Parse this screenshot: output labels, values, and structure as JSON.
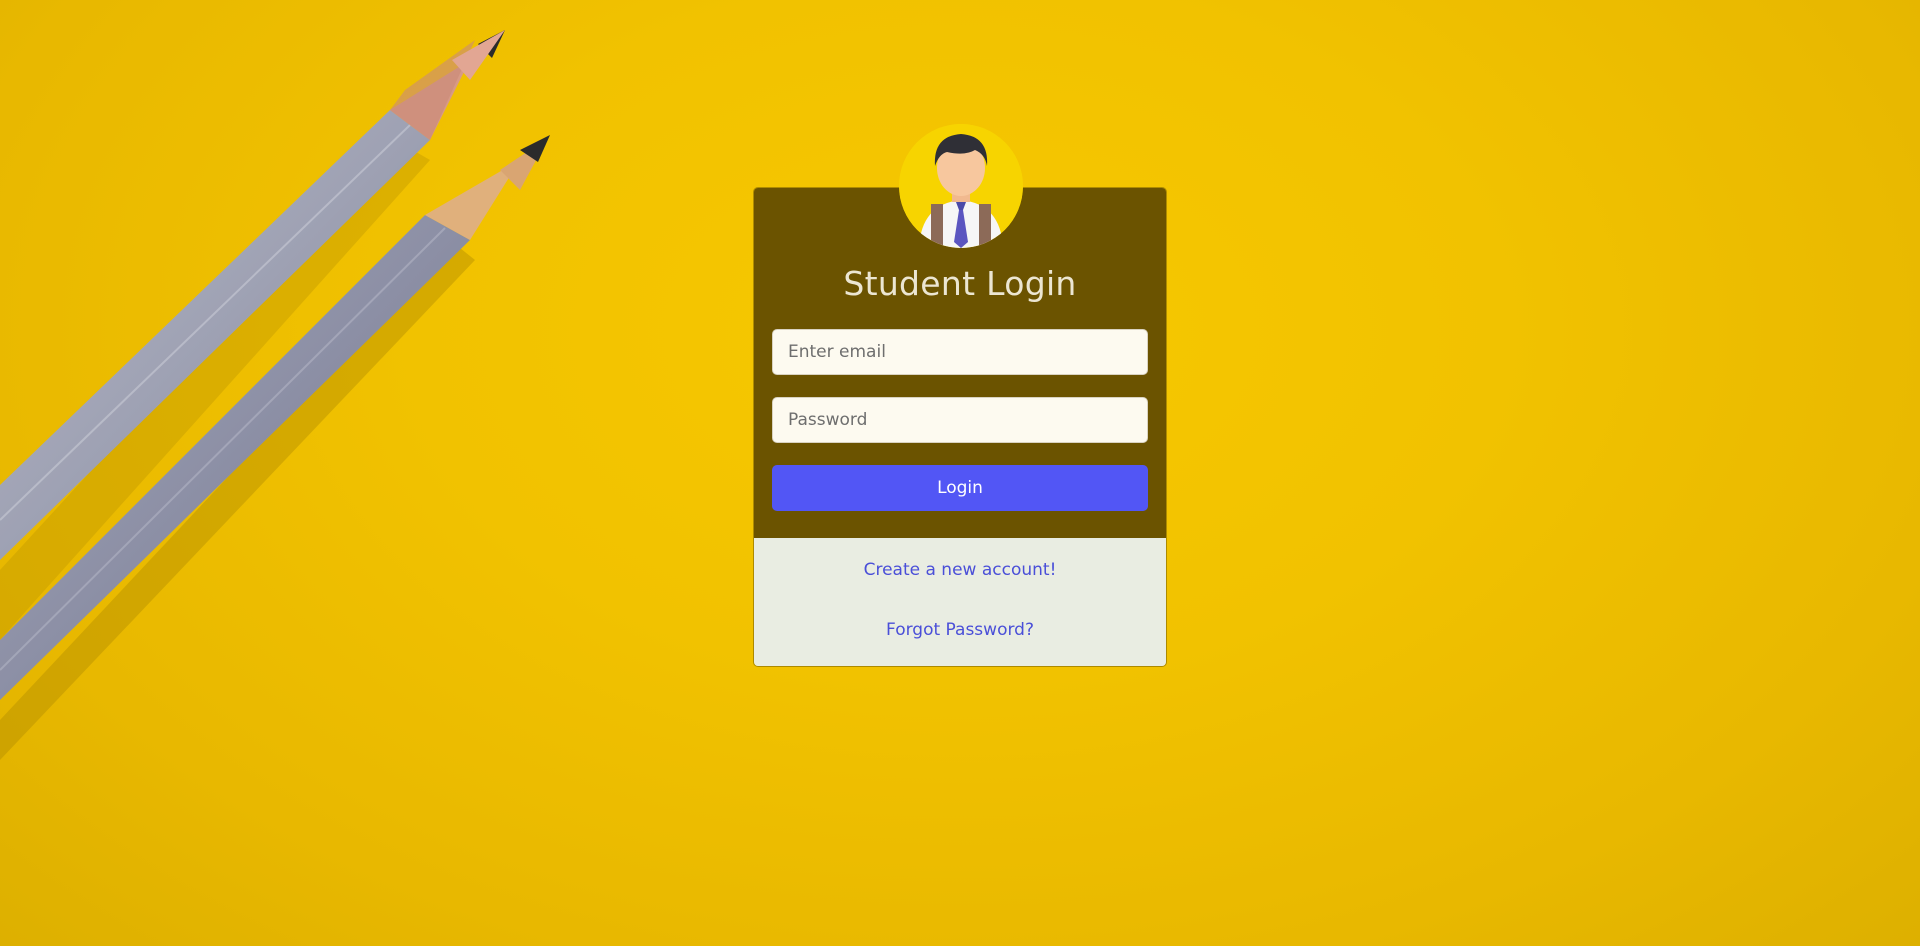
{
  "background": {
    "color": "#f1c200"
  },
  "login": {
    "title": "Student Login",
    "email_placeholder": "Enter email",
    "password_placeholder": "Password",
    "login_label": "Login",
    "create_account_label": "Create a new account!",
    "forgot_password_label": "Forgot Password?"
  },
  "colors": {
    "card_header": "#6b5300",
    "card_footer": "#e9ede2",
    "button": "#5256f5",
    "link": "#4a4fd8",
    "avatar_bg": "#f7d400"
  },
  "icons": {
    "avatar": "student-avatar-icon"
  }
}
